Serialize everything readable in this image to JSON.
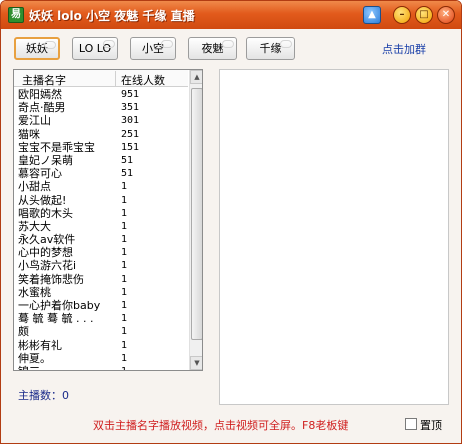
{
  "window": {
    "title": "妖妖 lolo 小空 夜魅 千缘 直播",
    "app_icon": "app-logo-icon"
  },
  "titlebar_buttons": {
    "skin": "shirt-icon",
    "minimize": "minimize-icon",
    "maximize": "maximize-icon",
    "close": "close-icon"
  },
  "tabs": [
    {
      "label": "妖妖",
      "selected": true
    },
    {
      "label": "LO LO",
      "selected": false
    },
    {
      "label": "小空",
      "selected": false
    },
    {
      "label": "夜魅",
      "selected": false
    },
    {
      "label": "千缘",
      "selected": false
    }
  ],
  "favorite_link": "点击加群",
  "list": {
    "columns": [
      "主播名字",
      "在线人数"
    ],
    "rows": [
      {
        "name": "欧阳嫣然",
        "count": "951"
      },
      {
        "name": "奇点·酷男",
        "count": "351"
      },
      {
        "name": "爱江山",
        "count": "301"
      },
      {
        "name": "猫咪",
        "count": "251"
      },
      {
        "name": "宝宝不是乖宝宝",
        "count": "151"
      },
      {
        "name": "皇妃ノ呆萌",
        "count": "51"
      },
      {
        "name": "慕容可心",
        "count": "51"
      },
      {
        "name": "小甜点",
        "count": "1"
      },
      {
        "name": "从头做起!",
        "count": "1"
      },
      {
        "name": "唱歌的木头",
        "count": "1"
      },
      {
        "name": "苏大大",
        "count": "1"
      },
      {
        "name": "永久av软件",
        "count": "1"
      },
      {
        "name": "心中的梦想",
        "count": "1"
      },
      {
        "name": "小鸟游六花i",
        "count": "1"
      },
      {
        "name": "笑着掩饰悲伤",
        "count": "1"
      },
      {
        "name": "水蜜桃",
        "count": "1"
      },
      {
        "name": "一心护着你baby",
        "count": "1"
      },
      {
        "name": "蓦 毓 蓦 毓 . . .",
        "count": "1"
      },
      {
        "name": "     颇",
        "count": "1"
      },
      {
        "name": "彬彬有礼",
        "count": "1"
      },
      {
        "name": "伸夏。",
        "count": "1"
      },
      {
        "name": "锦三",
        "count": "1"
      }
    ]
  },
  "host_count": {
    "label": "主播数：",
    "value": "0"
  },
  "hint": "双击主播名字播放视频，点击视频可全屏。F8老板键",
  "pin": {
    "label": "置顶",
    "checked": false
  }
}
